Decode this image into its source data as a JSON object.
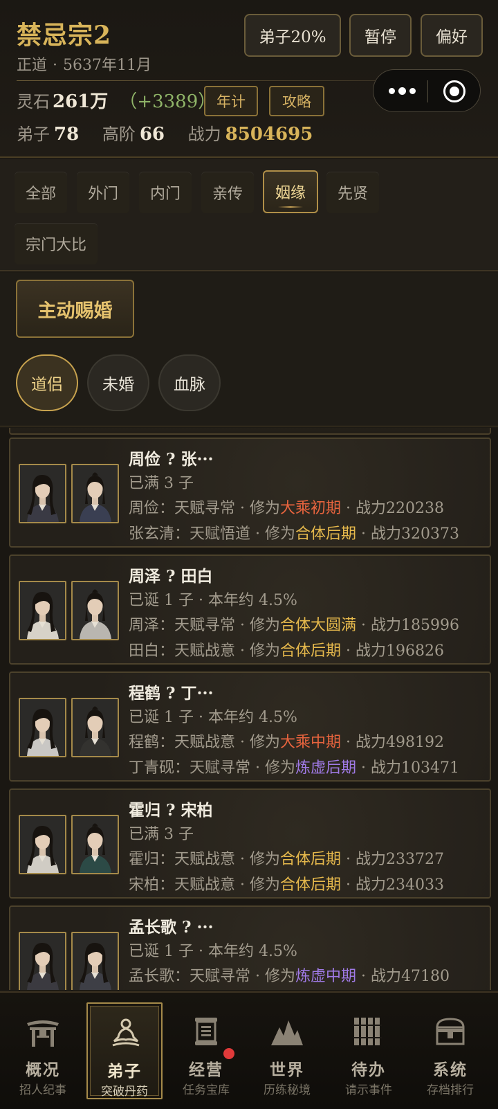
{
  "header": {
    "title": "禁忌宗2",
    "alignment": "正道",
    "date": "5637年11月",
    "separator": "·",
    "buttons": {
      "disciples_pct": "弟子20%",
      "pause": "暂停",
      "preferences": "偏好"
    },
    "spirit_stone_label": "灵石",
    "spirit_stone_value": "261万",
    "spirit_stone_delta": "（+3389）",
    "chip_yearly": "年计",
    "chip_guide": "攻略",
    "disciples_label": "弟子",
    "disciples_value": "78",
    "high_rank_label": "高阶",
    "high_rank_value": "66",
    "power_label": "战力",
    "power_value": "8504695"
  },
  "tabs": [
    {
      "label": "全部",
      "active": false
    },
    {
      "label": "外门",
      "active": false
    },
    {
      "label": "内门",
      "active": false
    },
    {
      "label": "亲传",
      "active": false
    },
    {
      "label": "姻缘",
      "active": true
    },
    {
      "label": "先贤",
      "active": false
    },
    {
      "label": "宗门大比",
      "active": false
    }
  ],
  "action": {
    "marry_button": "主动赐婚",
    "filters": [
      {
        "label": "道侣",
        "active": true
      },
      {
        "label": "未婚",
        "active": false
      },
      {
        "label": "血脉",
        "active": false
      }
    ]
  },
  "couples": [
    {
      "title": "周俭 ? 张···",
      "status": "已满 3 子",
      "a": {
        "prefix": "周俭：天赋寻常 · 修为",
        "realm": "大乘初期",
        "realm_color": "red",
        "suffix": " · 战力220238"
      },
      "b": {
        "prefix": "张玄清：天赋悟道 · 修为",
        "realm": "合体后期",
        "realm_color": "gold",
        "suffix": " · 战力320373"
      }
    },
    {
      "title": "周泽 ? 田白",
      "status": "已诞 1 子 · 本年约 4.5%",
      "a": {
        "prefix": "周泽：天赋寻常 · 修为",
        "realm": "合体大圆满",
        "realm_color": "gold",
        "suffix": " · 战力185996"
      },
      "b": {
        "prefix": "田白：天赋战意 · 修为",
        "realm": "合体后期",
        "realm_color": "gold",
        "suffix": " · 战力196826"
      }
    },
    {
      "title": "程鹤 ? 丁···",
      "status": "已诞 1 子 · 本年约 4.5%",
      "a": {
        "prefix": "程鹤：天赋战意 · 修为",
        "realm": "大乘中期",
        "realm_color": "red",
        "suffix": " · 战力498192"
      },
      "b": {
        "prefix": "丁青砚：天赋寻常 · 修为",
        "realm": "炼虚后期",
        "realm_color": "purple",
        "suffix": " · 战力103471"
      }
    },
    {
      "title": "霍归 ? 宋柏",
      "status": "已满 3 子",
      "a": {
        "prefix": "霍归：天赋战意 · 修为",
        "realm": "合体后期",
        "realm_color": "gold",
        "suffix": " · 战力233727"
      },
      "b": {
        "prefix": "宋柏：天赋战意 · 修为",
        "realm": "合体后期",
        "realm_color": "gold",
        "suffix": " · 战力234033"
      }
    },
    {
      "title": "孟长歌 ? ···",
      "status": "已诞 1 子 · 本年约 4.5%",
      "a": {
        "prefix": "孟长歌：天赋寻常 · 修为",
        "realm": "炼虚中期",
        "realm_color": "purple",
        "suffix": " · 战力47180"
      },
      "b": {
        "prefix": "",
        "realm": "",
        "realm_color": "",
        "suffix": ""
      }
    }
  ],
  "nav": [
    {
      "label": "概况",
      "sub": "招人纪事",
      "icon": "gate-icon",
      "active": false,
      "badge": false
    },
    {
      "label": "弟子",
      "sub": "突破丹药",
      "icon": "meditation-icon",
      "active": true,
      "badge": false
    },
    {
      "label": "经营",
      "sub": "任务宝库",
      "icon": "scroll-icon",
      "active": false,
      "badge": true
    },
    {
      "label": "世界",
      "sub": "历练秘境",
      "icon": "mountain-icon",
      "active": false,
      "badge": false
    },
    {
      "label": "待办",
      "sub": "请示事件",
      "icon": "bamboo-slips-icon",
      "active": false,
      "badge": false
    },
    {
      "label": "系统",
      "sub": "存档排行",
      "icon": "chest-icon",
      "active": false,
      "badge": false
    }
  ]
}
